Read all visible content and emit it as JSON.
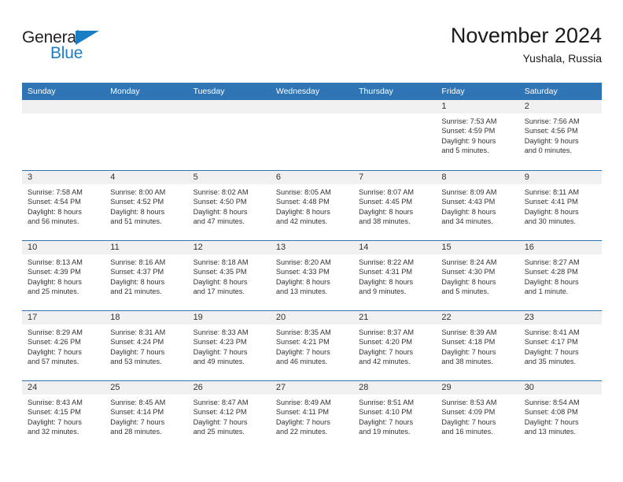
{
  "logo": {
    "word_one": "General",
    "word_two": "Blue",
    "triangle_color": "#1a7ec4",
    "text_color": "#231f20"
  },
  "header": {
    "title": "November 2024",
    "subtitle": "Yushala, Russia"
  },
  "theme": {
    "header_blue": "#2f75b5",
    "day_strip_gray": "#f0f0f0",
    "text_color": "#333333"
  },
  "weekdays": [
    "Sunday",
    "Monday",
    "Tuesday",
    "Wednesday",
    "Thursday",
    "Friday",
    "Saturday"
  ],
  "weeks": [
    [
      {
        "day": "",
        "sunrise": "",
        "sunset": "",
        "daylight_1": "",
        "daylight_2": ""
      },
      {
        "day": "",
        "sunrise": "",
        "sunset": "",
        "daylight_1": "",
        "daylight_2": ""
      },
      {
        "day": "",
        "sunrise": "",
        "sunset": "",
        "daylight_1": "",
        "daylight_2": ""
      },
      {
        "day": "",
        "sunrise": "",
        "sunset": "",
        "daylight_1": "",
        "daylight_2": ""
      },
      {
        "day": "",
        "sunrise": "",
        "sunset": "",
        "daylight_1": "",
        "daylight_2": ""
      },
      {
        "day": "1",
        "sunrise": "Sunrise: 7:53 AM",
        "sunset": "Sunset: 4:59 PM",
        "daylight_1": "Daylight: 9 hours",
        "daylight_2": "and 5 minutes."
      },
      {
        "day": "2",
        "sunrise": "Sunrise: 7:56 AM",
        "sunset": "Sunset: 4:56 PM",
        "daylight_1": "Daylight: 9 hours",
        "daylight_2": "and 0 minutes."
      }
    ],
    [
      {
        "day": "3",
        "sunrise": "Sunrise: 7:58 AM",
        "sunset": "Sunset: 4:54 PM",
        "daylight_1": "Daylight: 8 hours",
        "daylight_2": "and 56 minutes."
      },
      {
        "day": "4",
        "sunrise": "Sunrise: 8:00 AM",
        "sunset": "Sunset: 4:52 PM",
        "daylight_1": "Daylight: 8 hours",
        "daylight_2": "and 51 minutes."
      },
      {
        "day": "5",
        "sunrise": "Sunrise: 8:02 AM",
        "sunset": "Sunset: 4:50 PM",
        "daylight_1": "Daylight: 8 hours",
        "daylight_2": "and 47 minutes."
      },
      {
        "day": "6",
        "sunrise": "Sunrise: 8:05 AM",
        "sunset": "Sunset: 4:48 PM",
        "daylight_1": "Daylight: 8 hours",
        "daylight_2": "and 42 minutes."
      },
      {
        "day": "7",
        "sunrise": "Sunrise: 8:07 AM",
        "sunset": "Sunset: 4:45 PM",
        "daylight_1": "Daylight: 8 hours",
        "daylight_2": "and 38 minutes."
      },
      {
        "day": "8",
        "sunrise": "Sunrise: 8:09 AM",
        "sunset": "Sunset: 4:43 PM",
        "daylight_1": "Daylight: 8 hours",
        "daylight_2": "and 34 minutes."
      },
      {
        "day": "9",
        "sunrise": "Sunrise: 8:11 AM",
        "sunset": "Sunset: 4:41 PM",
        "daylight_1": "Daylight: 8 hours",
        "daylight_2": "and 30 minutes."
      }
    ],
    [
      {
        "day": "10",
        "sunrise": "Sunrise: 8:13 AM",
        "sunset": "Sunset: 4:39 PM",
        "daylight_1": "Daylight: 8 hours",
        "daylight_2": "and 25 minutes."
      },
      {
        "day": "11",
        "sunrise": "Sunrise: 8:16 AM",
        "sunset": "Sunset: 4:37 PM",
        "daylight_1": "Daylight: 8 hours",
        "daylight_2": "and 21 minutes."
      },
      {
        "day": "12",
        "sunrise": "Sunrise: 8:18 AM",
        "sunset": "Sunset: 4:35 PM",
        "daylight_1": "Daylight: 8 hours",
        "daylight_2": "and 17 minutes."
      },
      {
        "day": "13",
        "sunrise": "Sunrise: 8:20 AM",
        "sunset": "Sunset: 4:33 PM",
        "daylight_1": "Daylight: 8 hours",
        "daylight_2": "and 13 minutes."
      },
      {
        "day": "14",
        "sunrise": "Sunrise: 8:22 AM",
        "sunset": "Sunset: 4:31 PM",
        "daylight_1": "Daylight: 8 hours",
        "daylight_2": "and 9 minutes."
      },
      {
        "day": "15",
        "sunrise": "Sunrise: 8:24 AM",
        "sunset": "Sunset: 4:30 PM",
        "daylight_1": "Daylight: 8 hours",
        "daylight_2": "and 5 minutes."
      },
      {
        "day": "16",
        "sunrise": "Sunrise: 8:27 AM",
        "sunset": "Sunset: 4:28 PM",
        "daylight_1": "Daylight: 8 hours",
        "daylight_2": "and 1 minute."
      }
    ],
    [
      {
        "day": "17",
        "sunrise": "Sunrise: 8:29 AM",
        "sunset": "Sunset: 4:26 PM",
        "daylight_1": "Daylight: 7 hours",
        "daylight_2": "and 57 minutes."
      },
      {
        "day": "18",
        "sunrise": "Sunrise: 8:31 AM",
        "sunset": "Sunset: 4:24 PM",
        "daylight_1": "Daylight: 7 hours",
        "daylight_2": "and 53 minutes."
      },
      {
        "day": "19",
        "sunrise": "Sunrise: 8:33 AM",
        "sunset": "Sunset: 4:23 PM",
        "daylight_1": "Daylight: 7 hours",
        "daylight_2": "and 49 minutes."
      },
      {
        "day": "20",
        "sunrise": "Sunrise: 8:35 AM",
        "sunset": "Sunset: 4:21 PM",
        "daylight_1": "Daylight: 7 hours",
        "daylight_2": "and 46 minutes."
      },
      {
        "day": "21",
        "sunrise": "Sunrise: 8:37 AM",
        "sunset": "Sunset: 4:20 PM",
        "daylight_1": "Daylight: 7 hours",
        "daylight_2": "and 42 minutes."
      },
      {
        "day": "22",
        "sunrise": "Sunrise: 8:39 AM",
        "sunset": "Sunset: 4:18 PM",
        "daylight_1": "Daylight: 7 hours",
        "daylight_2": "and 38 minutes."
      },
      {
        "day": "23",
        "sunrise": "Sunrise: 8:41 AM",
        "sunset": "Sunset: 4:17 PM",
        "daylight_1": "Daylight: 7 hours",
        "daylight_2": "and 35 minutes."
      }
    ],
    [
      {
        "day": "24",
        "sunrise": "Sunrise: 8:43 AM",
        "sunset": "Sunset: 4:15 PM",
        "daylight_1": "Daylight: 7 hours",
        "daylight_2": "and 32 minutes."
      },
      {
        "day": "25",
        "sunrise": "Sunrise: 8:45 AM",
        "sunset": "Sunset: 4:14 PM",
        "daylight_1": "Daylight: 7 hours",
        "daylight_2": "and 28 minutes."
      },
      {
        "day": "26",
        "sunrise": "Sunrise: 8:47 AM",
        "sunset": "Sunset: 4:12 PM",
        "daylight_1": "Daylight: 7 hours",
        "daylight_2": "and 25 minutes."
      },
      {
        "day": "27",
        "sunrise": "Sunrise: 8:49 AM",
        "sunset": "Sunset: 4:11 PM",
        "daylight_1": "Daylight: 7 hours",
        "daylight_2": "and 22 minutes."
      },
      {
        "day": "28",
        "sunrise": "Sunrise: 8:51 AM",
        "sunset": "Sunset: 4:10 PM",
        "daylight_1": "Daylight: 7 hours",
        "daylight_2": "and 19 minutes."
      },
      {
        "day": "29",
        "sunrise": "Sunrise: 8:53 AM",
        "sunset": "Sunset: 4:09 PM",
        "daylight_1": "Daylight: 7 hours",
        "daylight_2": "and 16 minutes."
      },
      {
        "day": "30",
        "sunrise": "Sunrise: 8:54 AM",
        "sunset": "Sunset: 4:08 PM",
        "daylight_1": "Daylight: 7 hours",
        "daylight_2": "and 13 minutes."
      }
    ]
  ]
}
